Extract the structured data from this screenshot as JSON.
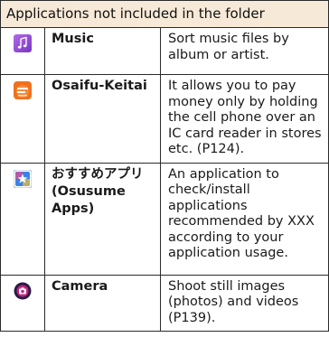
{
  "table": {
    "header": "Applications not included in the folder",
    "rows": [
      {
        "icon": "music-note-icon",
        "name": "Music",
        "description": "Sort music files by album or artist."
      },
      {
        "icon": "osaifu-keitai-icon",
        "name": "Osaifu-Keitai",
        "description": "It allows you to pay money only by holding the cell phone over an IC card reader in stores etc. (P124)."
      },
      {
        "icon": "osusume-apps-star-icon",
        "name": "おすすめアプリ(Osusume Apps)",
        "description": "An application to check/install applications recommended by XXX according to your application usage."
      },
      {
        "icon": "camera-icon",
        "name": "Camera",
        "description": "Shoot still images (photos) and videos (P139)."
      }
    ]
  },
  "colors": {
    "header_bg": "#f7e9d7",
    "border": "#2b2b2b",
    "music_icon": "#9a4fd6",
    "osaifu_icon": "#f0701e",
    "osusume_icon": "#3b82e8",
    "camera_icon": "#2a1a4a"
  }
}
